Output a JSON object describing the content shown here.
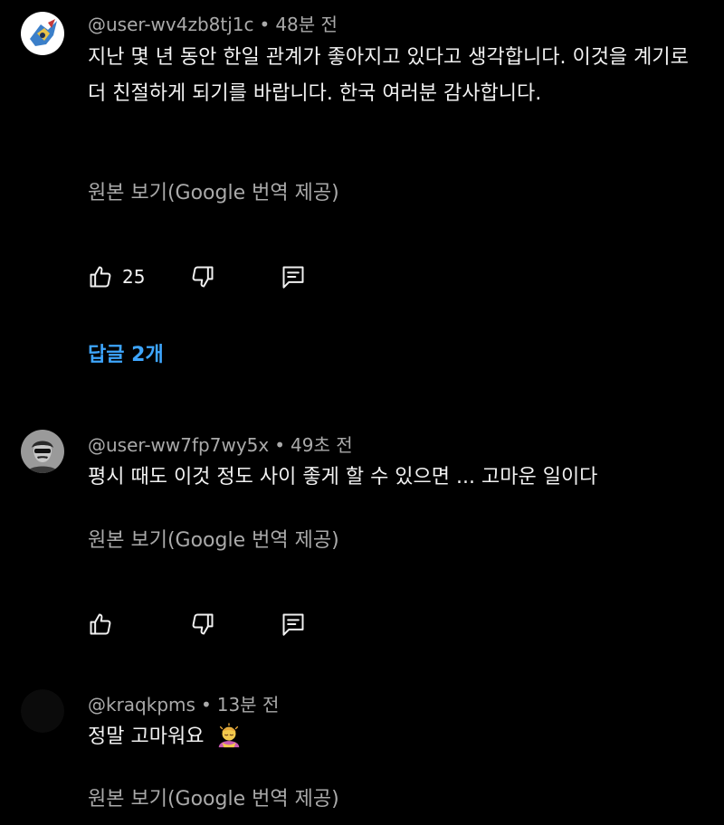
{
  "comments": [
    {
      "author": "@user-wv4zb8tj1c",
      "separator": "•",
      "time": "48분 전",
      "text": "지난 몇 년 동안 한일 관계가 좋아지고 있다고 생각합니다. 이것을 계기로 더 친절하게 되기를 바랍니다. 한국 여러분 감사합니다.",
      "translate_link": "원본 보기(Google 번역 제공)",
      "like_count": "25",
      "replies_label": "답글 2개"
    },
    {
      "author": "@user-ww7fp7wy5x",
      "separator": "•",
      "time": "49초 전",
      "text": "평시 때도 이것 정도 사이 좋게 할 수 있으면 ... 고마운 일이다",
      "translate_link": "원본 보기(Google 번역 제공)"
    },
    {
      "author": "@kraqkpms",
      "separator": "•",
      "time": "13분 전",
      "text": "정말 고마워요",
      "translate_link": "원본 보기(Google 번역 제공)"
    }
  ],
  "icons": {
    "like": "thumbs-up-icon",
    "dislike": "thumbs-down-icon",
    "reply": "reply-icon",
    "emoji": "person-bowing-emoji"
  },
  "colors": {
    "background": "#000000",
    "primary_text": "#f1f1f1",
    "secondary_text": "#aaaaaa",
    "link_blue": "#3ea6ff"
  }
}
